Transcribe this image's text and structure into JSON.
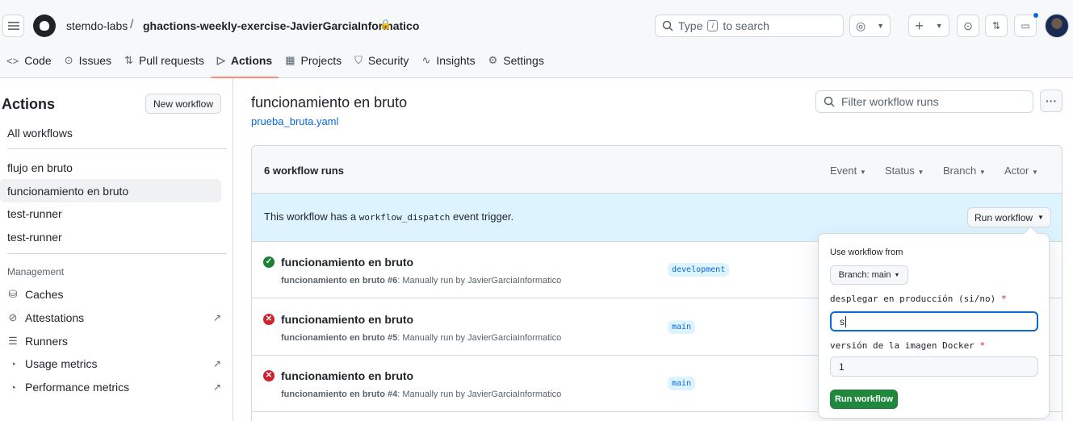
{
  "header": {
    "owner": "stemdo-labs",
    "separator": "/",
    "repo": "ghactions-weekly-exercise-JavierGarciaInformatico",
    "search_placeholder": "Type",
    "search_suffix": "to search",
    "search_key": "/"
  },
  "nav": {
    "tabs": [
      {
        "label": "Code",
        "icon": "code-icon"
      },
      {
        "label": "Issues",
        "icon": "issue-icon"
      },
      {
        "label": "Pull requests",
        "icon": "pull-request-icon"
      },
      {
        "label": "Actions",
        "icon": "play-icon",
        "active": true
      },
      {
        "label": "Projects",
        "icon": "table-icon"
      },
      {
        "label": "Security",
        "icon": "shield-icon"
      },
      {
        "label": "Insights",
        "icon": "graph-icon"
      },
      {
        "label": "Settings",
        "icon": "gear-icon"
      }
    ]
  },
  "sidebar": {
    "title": "Actions",
    "new_workflow": "New workflow",
    "all_workflows": "All workflows",
    "workflows": [
      "flujo en bruto",
      "funcionamiento en bruto",
      "test-runner",
      "test-runner"
    ],
    "management_label": "Management",
    "management": [
      {
        "label": "Caches",
        "icon": "database-icon",
        "external": false
      },
      {
        "label": "Attestations",
        "icon": "verified-icon",
        "external": true
      },
      {
        "label": "Runners",
        "icon": "server-icon",
        "external": false
      },
      {
        "label": "Usage metrics",
        "icon": "meter-icon",
        "external": true
      },
      {
        "label": "Performance metrics",
        "icon": "meter-icon",
        "external": true
      }
    ]
  },
  "main": {
    "title": "funcionamiento en bruto",
    "file": "prueba_bruta.yaml",
    "filter_placeholder": "Filter workflow runs",
    "runs_count": "6 workflow runs",
    "filters": [
      "Event",
      "Status",
      "Branch",
      "Actor"
    ],
    "banner_prefix": "This workflow has a",
    "banner_code": "workflow_dispatch",
    "banner_suffix": "event trigger.",
    "run_workflow_button": "Run workflow",
    "runs": [
      {
        "title": "funcionamiento en bruto",
        "workflow": "funcionamiento en bruto",
        "number": "#6",
        "detail": ": Manually run by JavierGarciaInformatico",
        "branch": "development",
        "status": "success"
      },
      {
        "title": "funcionamiento en bruto",
        "workflow": "funcionamiento en bruto",
        "number": "#5",
        "detail": ": Manually run by JavierGarciaInformatico",
        "branch": "main",
        "status": "failure"
      },
      {
        "title": "funcionamiento en bruto",
        "workflow": "funcionamiento en bruto",
        "number": "#4",
        "detail": ": Manually run by JavierGarciaInformatico",
        "branch": "main",
        "status": "failure"
      }
    ]
  },
  "popover": {
    "use_from": "Use workflow from",
    "branch_button": "Branch: main",
    "q1_label": "desplegar en producción (si/no)",
    "q1_value": "s",
    "q2_label": "versión de la imagen Docker",
    "q2_value": "1",
    "required_mark": "*",
    "run_button": "Run workflow"
  },
  "colors": {
    "accent": "#0969da",
    "success": "#1a7f37",
    "failure": "#cf222e",
    "run_button": "#1f883d",
    "active_tab_underline": "#fd8c73",
    "banner_bg": "#ddf4ff"
  }
}
